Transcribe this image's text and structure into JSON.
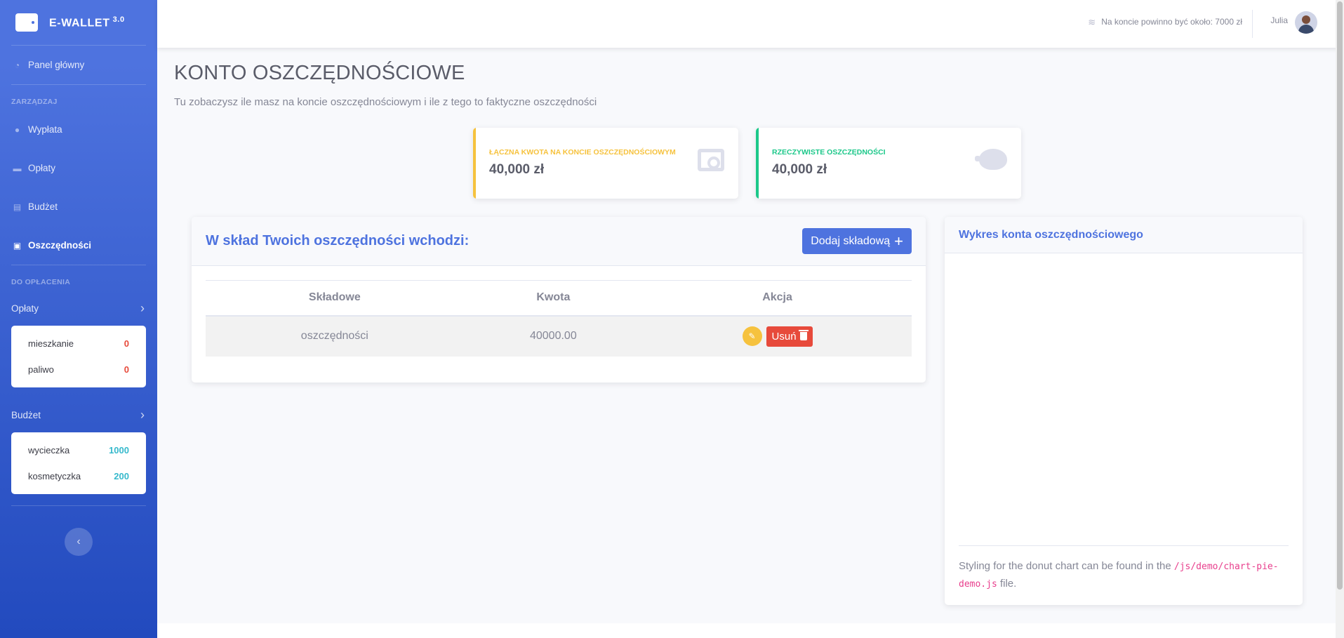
{
  "brand": {
    "name": "E-WALLET",
    "version": "3.0"
  },
  "sidebar": {
    "dashboard": "Panel główny",
    "heading_manage": "ZARZĄDZAJ",
    "items": [
      {
        "label": "Wypłata",
        "icon": "money-bag-icon"
      },
      {
        "label": "Opłaty",
        "icon": "hand-coin-icon"
      },
      {
        "label": "Budżet",
        "icon": "banknote-icon"
      },
      {
        "label": "Oszczędności",
        "icon": "safe-icon",
        "active": true
      }
    ],
    "heading_topay": "DO OPŁACENIA",
    "fees": {
      "label": "Opłaty",
      "rows": [
        {
          "name": "mieszkanie",
          "value": "0"
        },
        {
          "name": "paliwo",
          "value": "0"
        }
      ]
    },
    "budget": {
      "label": "Budżet",
      "rows": [
        {
          "name": "wycieczka",
          "value": "1000"
        },
        {
          "name": "kosmetyczka",
          "value": "200"
        }
      ]
    }
  },
  "topbar": {
    "balance": "Na koncie powinno być około: 7000 zł",
    "user": "Julia"
  },
  "page": {
    "title": "KONTO OSZCZĘDNOŚCIOWE",
    "subtitle": "Tu zobaczysz ile masz na koncie oszczędnościowym i ile z tego to faktyczne oszczędności"
  },
  "stats": [
    {
      "label": "ŁĄCZNA KWOTA NA KONCIE OSZCZĘDNOŚCIOWYM",
      "value": "40,000 zł",
      "color": "#f6c23e"
    },
    {
      "label": "RZECZYWISTE OSZCZĘDNOŚCI",
      "value": "40,000 zł",
      "color": "#1cc88a"
    }
  ],
  "components": {
    "title": "W skład Twoich oszczędności wchodzi:",
    "add_label": "Dodaj składową",
    "columns": [
      "Składowe",
      "Kwota",
      "Akcja"
    ],
    "rows": [
      {
        "name": "oszczędności",
        "amount": "40000.00"
      }
    ],
    "delete_label": "Usuń"
  },
  "chart_card": {
    "title": "Wykres konta oszczędnościowego",
    "foot_text": "Styling for the donut chart can be found in the",
    "foot_code": "/js/demo/chart-pie-demo.js",
    "foot_end": "file."
  },
  "colors": {
    "primary": "#4e73df",
    "warning": "#f6c23e",
    "success": "#1cc88a",
    "danger": "#e74a3b",
    "info": "#36b9cc"
  }
}
